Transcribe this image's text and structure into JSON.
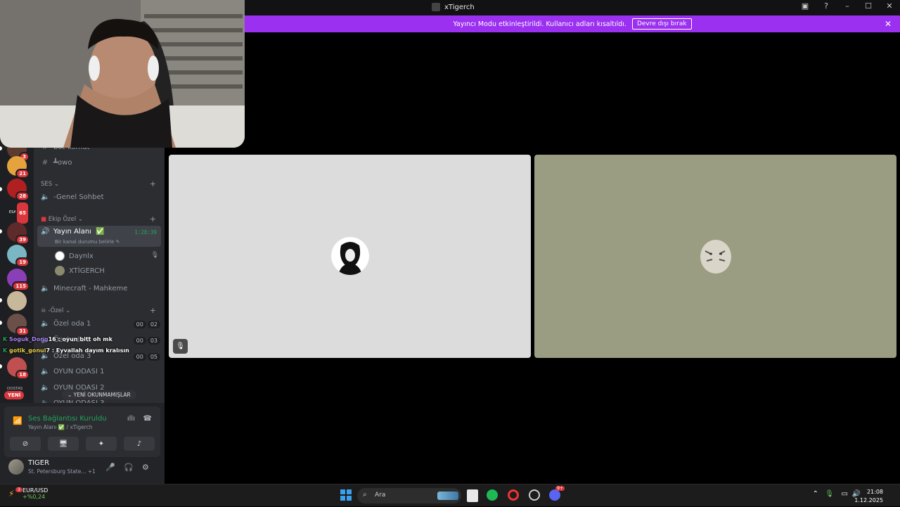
{
  "window": {
    "title": "xTigerch",
    "controls": [
      "inbox",
      "help",
      "minimize",
      "maximize",
      "close"
    ]
  },
  "streamer_banner": {
    "text": "Yayıncı Modu etkinleştirildi. Kullanıcı adları kısaltıldı.",
    "button": "Devre dışı bırak"
  },
  "servers": [
    {
      "badge": "3"
    },
    {
      "badge": "21"
    },
    {
      "badge": "28"
    },
    {
      "label": "ESATAKA",
      "badge": "65"
    },
    {
      "badge": "39"
    },
    {
      "badge": "19"
    },
    {
      "badge": "115"
    },
    {
      "badge": ""
    },
    {
      "badge": "31"
    },
    {
      "badge": "18"
    },
    {
      "label": "DOSTAS"
    }
  ],
  "new_badge": "YENİ",
  "channels": {
    "text": [
      {
        "label": "bot-komut"
      },
      {
        "label": "┻owo"
      }
    ],
    "voice_category": "SES",
    "voice": [
      {
        "label": "-Genel Sohbet"
      }
    ],
    "ekip_category": "Ekip Özel",
    "active_channel": {
      "label": "Yayın Alanı",
      "timer": "1:28:39",
      "status": "Bir kanal durumu belirle"
    },
    "active_members": [
      {
        "name": "Daynlx"
      },
      {
        "name": "XTİGERCH"
      }
    ],
    "minecraft": "Minecraft - Mahkeme",
    "ozel_category": "-Özel",
    "ozel_rooms": [
      {
        "label": "Özel oda 1",
        "count": "00",
        "limit": "02"
      },
      {
        "label": "Özel oda 2",
        "count": "00",
        "limit": "03"
      },
      {
        "label": "Özel oda 3",
        "count": "00",
        "limit": "05"
      },
      {
        "label": "OYUN ODASI 1"
      },
      {
        "label": "OYUN ODASI 2"
      },
      {
        "label": "OYUN ODASI 3"
      }
    ],
    "unread": "YENİ OKUNMAMIŞLAR"
  },
  "chat_overlay": [
    {
      "user": "Soguk_Dong",
      "msg": "16 : oyun bitt oh mk"
    },
    {
      "user": "gotik_gonul",
      "msg": "7 : Eyvallah dayım kralısın"
    }
  ],
  "voice_connection": {
    "title": "Ses Bağlantısı Kuruldu",
    "subtitle": "Yayın Alanı ✅ / xTigerch"
  },
  "user": {
    "name": "TIGER",
    "status": "St. Petersburg State...",
    "extra": "+1"
  },
  "taskbar": {
    "ticker_name": "EUR/USD",
    "ticker_value": "+%0,24",
    "ticker_badge": "3",
    "search_placeholder": "Ara",
    "discord_badge": "9+",
    "time": "21:08",
    "date": "1.12.2025"
  },
  "colors": {
    "accent": "#9b30f0",
    "connected": "#23a55a",
    "badge": "#da373c"
  }
}
